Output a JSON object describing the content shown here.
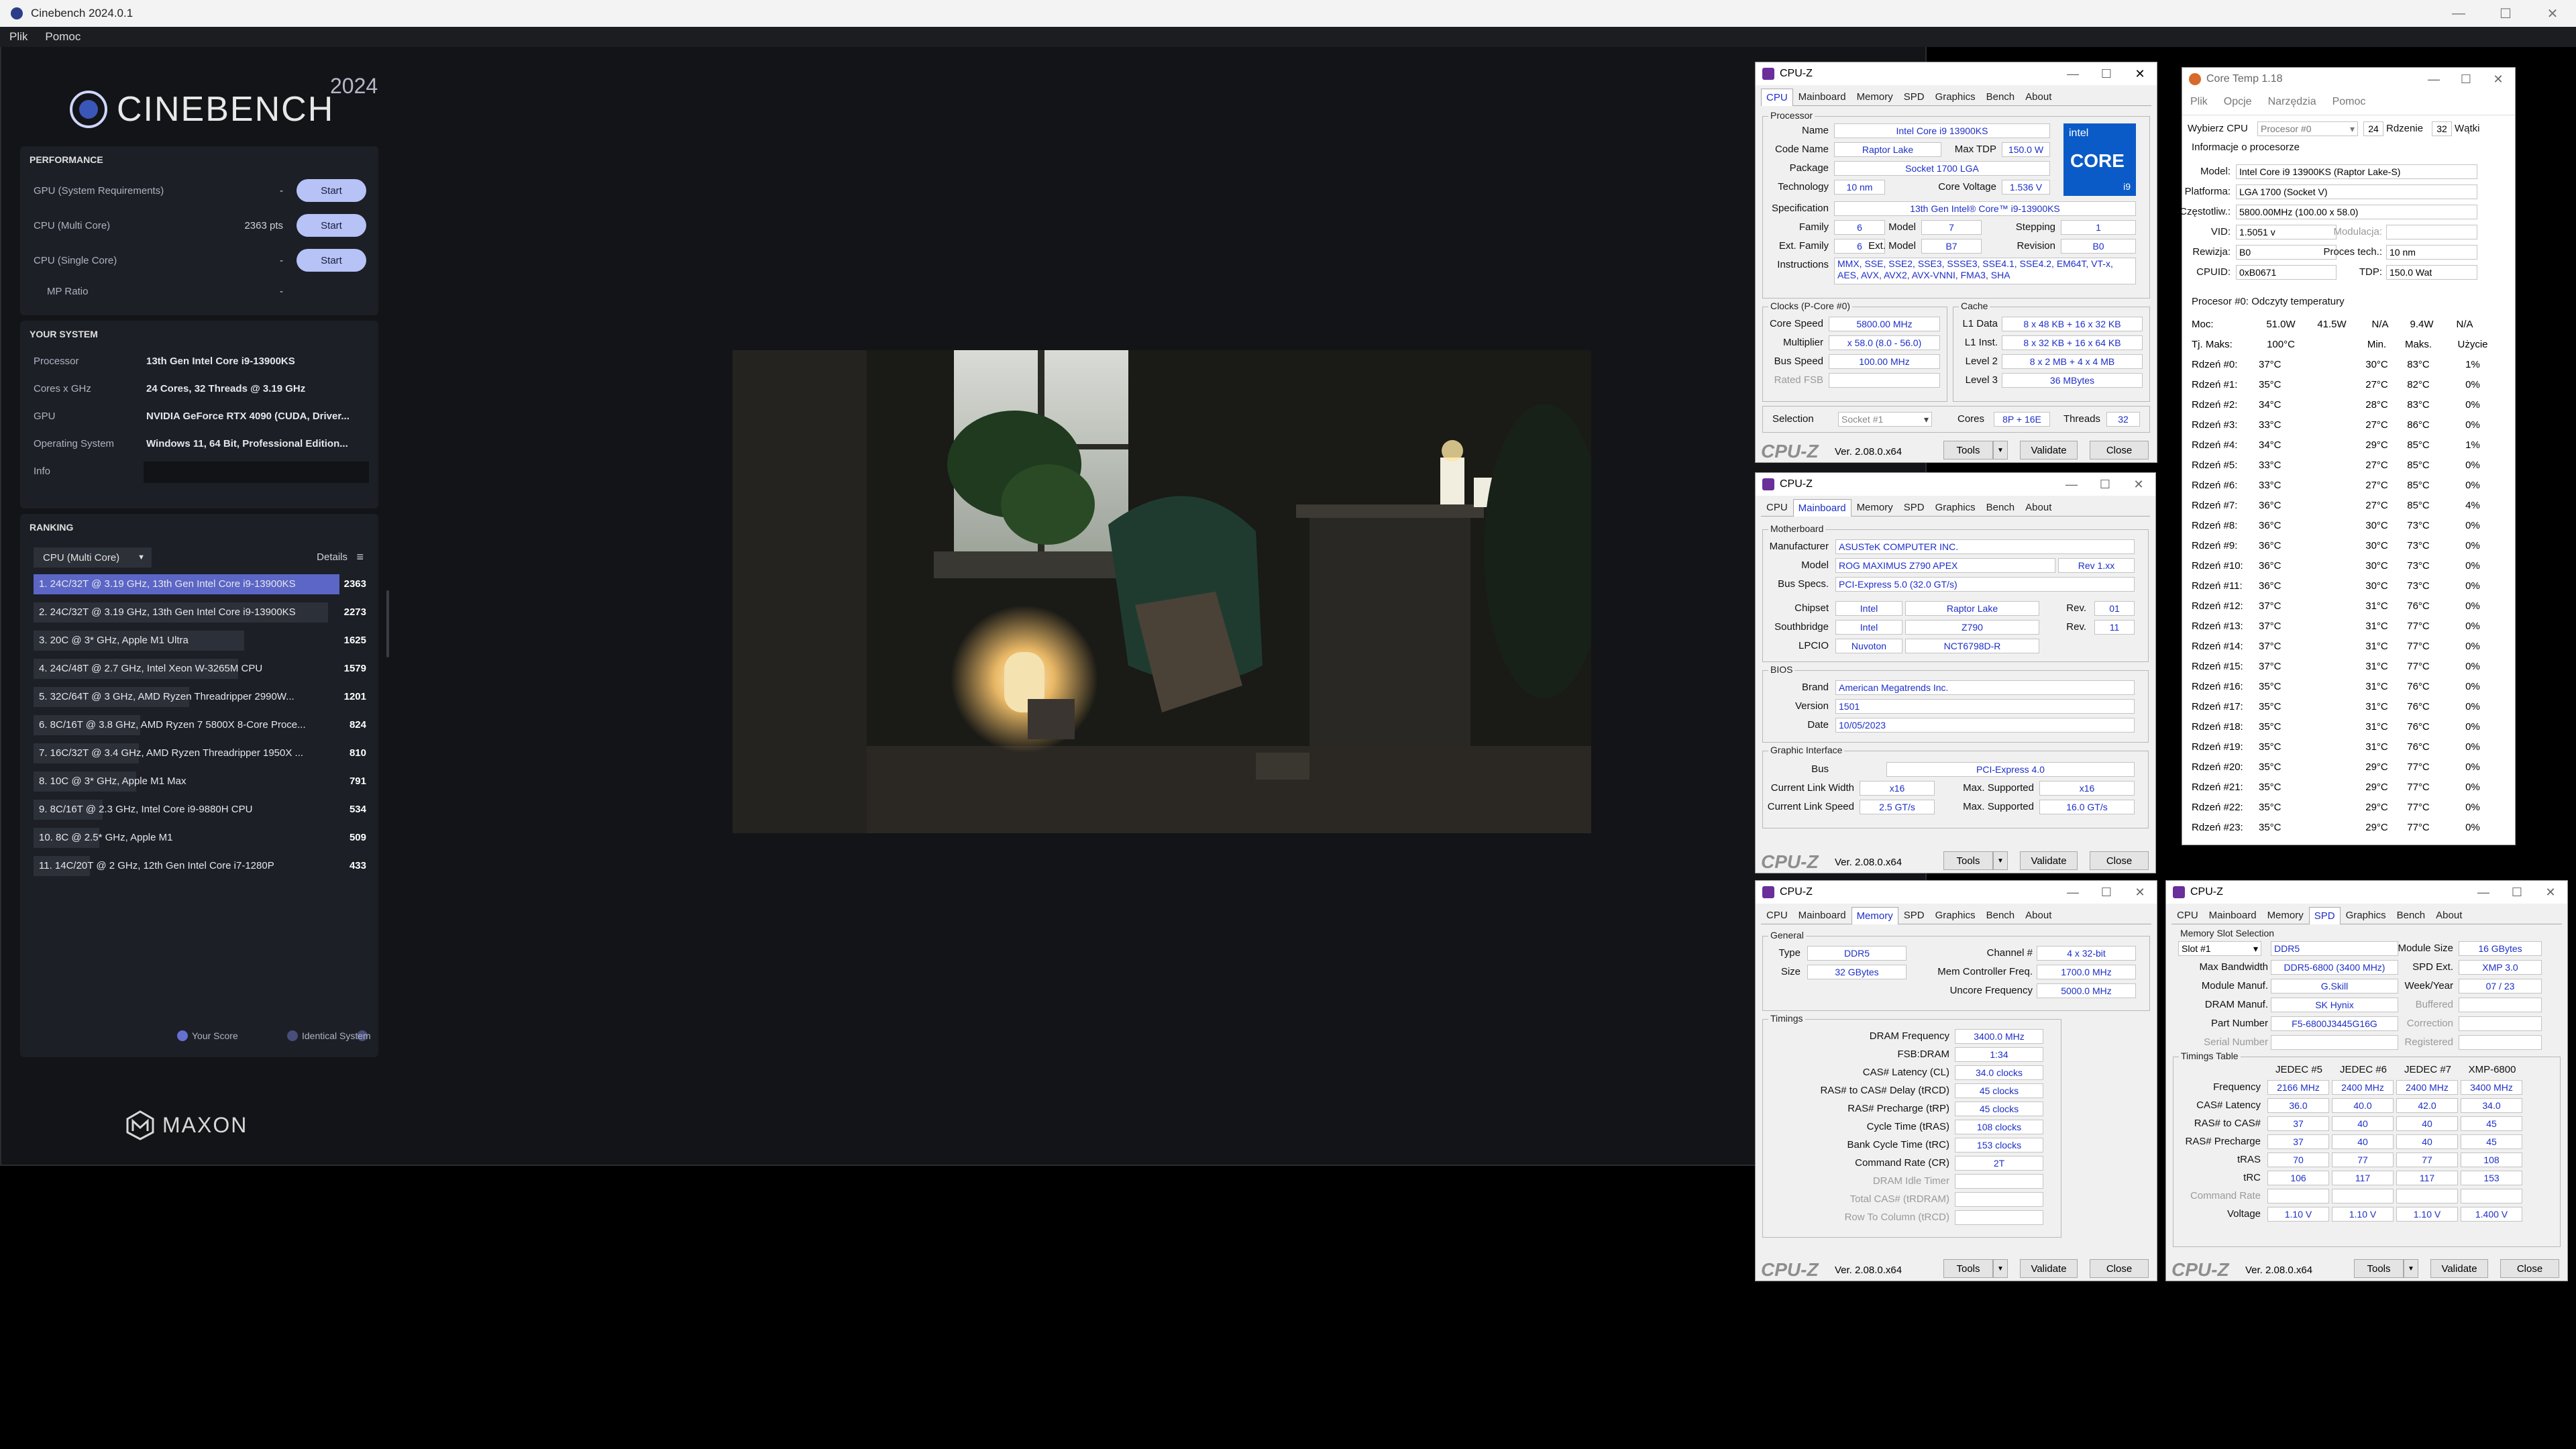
{
  "cinebench": {
    "window_title": "Cinebench 2024.0.1",
    "menu": [
      "Plik",
      "Pomoc"
    ],
    "logo_text": "CINEBENCH",
    "year": "2024",
    "performance": {
      "heading": "PERFORMANCE",
      "rows": [
        {
          "label": "GPU (System Requirements)",
          "value": "-",
          "button": "Start"
        },
        {
          "label": "CPU (Multi Core)",
          "value": "2363 pts",
          "button": "Start"
        },
        {
          "label": "CPU (Single Core)",
          "value": "-",
          "button": "Start"
        },
        {
          "label": "MP Ratio",
          "value": "-"
        }
      ]
    },
    "system": {
      "heading": "YOUR SYSTEM",
      "rows": [
        {
          "label": "Processor",
          "value": "13th Gen Intel Core i9-13900KS"
        },
        {
          "label": "Cores x GHz",
          "value": "24 Cores, 32 Threads @ 3.19 GHz"
        },
        {
          "label": "GPU",
          "value": "NVIDIA GeForce RTX 4090 (CUDA, Driver..."
        },
        {
          "label": "Operating System",
          "value": "Windows 11, 64 Bit, Professional Edition..."
        },
        {
          "label": "Info",
          "value": ""
        }
      ]
    },
    "ranking": {
      "heading": "RANKING",
      "dropdown": "CPU (Multi Core)",
      "details": "Details",
      "items": [
        {
          "label": "1. 24C/32T @ 3.19 GHz, 13th Gen Intel Core i9-13900KS",
          "score": "2363",
          "fraction": 1.0,
          "highlight": true
        },
        {
          "label": "2. 24C/32T @ 3.19 GHz, 13th Gen Intel Core i9-13900KS",
          "score": "2273",
          "fraction": 0.962,
          "highlight": false
        },
        {
          "label": "3. 20C @ 3* GHz, Apple M1 Ultra",
          "score": "1625",
          "fraction": 0.688,
          "highlight": false
        },
        {
          "label": "4. 24C/48T @ 2.7 GHz, Intel Xeon W-3265M CPU",
          "score": "1579",
          "fraction": 0.668,
          "highlight": false
        },
        {
          "label": "5. 32C/64T @ 3 GHz, AMD Ryzen Threadripper 2990W...",
          "score": "1201",
          "fraction": 0.508,
          "highlight": false
        },
        {
          "label": "6. 8C/16T @ 3.8 GHz, AMD Ryzen 7 5800X 8-Core Proce...",
          "score": "824",
          "fraction": 0.349,
          "highlight": false
        },
        {
          "label": "7. 16C/32T @ 3.4 GHz, AMD Ryzen Threadripper 1950X ...",
          "score": "810",
          "fraction": 0.343,
          "highlight": false
        },
        {
          "label": "8. 10C @ 3* GHz, Apple M1 Max",
          "score": "791",
          "fraction": 0.335,
          "highlight": false
        },
        {
          "label": "9. 8C/16T @ 2.3 GHz, Intel Core i9-9880H CPU",
          "score": "534",
          "fraction": 0.226,
          "highlight": false
        },
        {
          "label": "10. 8C @ 2.5* GHz, Apple M1",
          "score": "509",
          "fraction": 0.215,
          "highlight": false
        },
        {
          "label": "11. 14C/20T @ 2 GHz, 12th Gen Intel Core i7-1280P",
          "score": "433",
          "fraction": 0.183,
          "highlight": false
        }
      ],
      "legend": [
        "Your Score",
        "Identical System"
      ]
    },
    "maxon": "MAXON"
  },
  "cpuz_tabs": [
    "CPU",
    "Mainboard",
    "Memory",
    "SPD",
    "Graphics",
    "Bench",
    "About"
  ],
  "cpuz_common": {
    "title": "CPU-Z",
    "brand": "CPU-Z",
    "version": "Ver. 2.08.0.x64",
    "tools": "Tools",
    "validate": "Validate",
    "close": "Close"
  },
  "cpu": {
    "processor_legend": "Processor",
    "name_l": "Name",
    "name": "Intel Core i9 13900KS",
    "codename_l": "Code Name",
    "codename": "Raptor Lake",
    "maxtdp_l": "Max TDP",
    "maxtdp": "150.0 W",
    "package_l": "Package",
    "package": "Socket 1700 LGA",
    "tech_l": "Technology",
    "tech": "10 nm",
    "cv_l": "Core Voltage",
    "cv": "1.536 V",
    "spec_l": "Specification",
    "spec": "13th Gen Intel® Core™ i9-13900KS",
    "family_l": "Family",
    "family": "6",
    "model_l": "Model",
    "model": "7",
    "stepping_l": "Stepping",
    "stepping": "1",
    "extfam_l": "Ext. Family",
    "extfam": "6",
    "extmod_l": "Ext. Model",
    "extmod": "B7",
    "rev_l": "Revision",
    "rev": "B0",
    "instr_l": "Instructions",
    "instr": "MMX, SSE, SSE2, SSE3, SSSE3, SSE4.1, SSE4.2, EM64T, VT-x, AES, AVX, AVX2, AVX-VNNI, FMA3, SHA",
    "intel_badge": [
      "intel",
      "CORE",
      "i9"
    ],
    "clocks_legend": "Clocks (P-Core #0)",
    "cs_l": "Core Speed",
    "cs": "5800.00 MHz",
    "mult_l": "Multiplier",
    "mult": "x 58.0 (8.0 - 56.0)",
    "bus_l": "Bus Speed",
    "bus": "100.00 MHz",
    "fsb_l": "Rated FSB",
    "cache_legend": "Cache",
    "l1d_l": "L1 Data",
    "l1d": "8 x 48 KB + 16 x 32 KB",
    "l1i_l": "L1 Inst.",
    "l1i": "8 x 32 KB + 16 x 64 KB",
    "l2_l": "Level 2",
    "l2": "8 x 2 MB + 4 x 4 MB",
    "l3_l": "Level 3",
    "l3": "36 MBytes",
    "sel_l": "Selection",
    "sel": "Socket #1",
    "cores_l": "Cores",
    "cores": "8P + 16E",
    "threads_l": "Threads",
    "threads": "32"
  },
  "mainboard": {
    "mb_legend": "Motherboard",
    "manu_l": "Manufacturer",
    "manu": "ASUSTeK COMPUTER INC.",
    "model_l": "Model",
    "model": "ROG MAXIMUS Z790 APEX",
    "rev": "Rev 1.xx",
    "busspec_l": "Bus Specs.",
    "busspec": "PCI-Express 5.0 (32.0 GT/s)",
    "chipset_l": "Chipset",
    "chipset": "Intel",
    "chipset2": "Raptor Lake",
    "chiprev_l": "Rev.",
    "chiprev": "01",
    "south_l": "Southbridge",
    "south": "Intel",
    "south2": "Z790",
    "southrev_l": "Rev.",
    "southrev": "11",
    "lpcio_l": "LPCIO",
    "lpcio": "Nuvoton",
    "lpcio2": "NCT6798D-R",
    "bios_legend": "BIOS",
    "brand_l": "Brand",
    "brand": "American Megatrends Inc.",
    "version_l": "Version",
    "version": "1501",
    "date_l": "Date",
    "date": "10/05/2023",
    "gi_legend": "Graphic Interface",
    "gbus_l": "Bus",
    "gbus": "PCI-Express 4.0",
    "clw_l": "Current Link Width",
    "clw": "x16",
    "msw_l": "Max. Supported",
    "msw": "x16",
    "cls_l": "Current Link Speed",
    "cls": "2.5 GT/s",
    "mss_l": "Max. Supported",
    "mss": "16.0 GT/s"
  },
  "memory": {
    "gen_legend": "General",
    "type_l": "Type",
    "type": "DDR5",
    "size_l": "Size",
    "size": "32 GBytes",
    "chan_l": "Channel #",
    "chan": "4 x 32-bit",
    "mcf_l": "Mem Controller Freq.",
    "mcf": "1700.0 MHz",
    "ucf_l": "Uncore Frequency",
    "ucf": "5000.0 MHz",
    "tim_legend": "Timings",
    "timings": [
      {
        "l": "DRAM Frequency",
        "v": "3400.0 MHz",
        "dim": false
      },
      {
        "l": "FSB:DRAM",
        "v": "1:34",
        "dim": false
      },
      {
        "l": "CAS# Latency (CL)",
        "v": "34.0 clocks",
        "dim": false
      },
      {
        "l": "RAS# to CAS# Delay (tRCD)",
        "v": "45 clocks",
        "dim": false
      },
      {
        "l": "RAS# Precharge (tRP)",
        "v": "45 clocks",
        "dim": false
      },
      {
        "l": "Cycle Time (tRAS)",
        "v": "108 clocks",
        "dim": false
      },
      {
        "l": "Bank Cycle Time (tRC)",
        "v": "153 clocks",
        "dim": false
      },
      {
        "l": "Command Rate (CR)",
        "v": "2T",
        "dim": false
      },
      {
        "l": "DRAM Idle Timer",
        "v": "",
        "dim": true
      },
      {
        "l": "Total CAS# (tRDRAM)",
        "v": "",
        "dim": true
      },
      {
        "l": "Row To Column (tRCD)",
        "v": "",
        "dim": true
      }
    ]
  },
  "spd": {
    "slot_legend": "Memory Slot Selection",
    "slot": "Slot #1",
    "type": "DDR5",
    "modsize_l": "Module Size",
    "modsize": "16 GBytes",
    "maxbw_l": "Max Bandwidth",
    "maxbw": "DDR5-6800 (3400 MHz)",
    "spdext_l": "SPD Ext.",
    "spdext": "XMP 3.0",
    "modmanu_l": "Module Manuf.",
    "modmanu": "G.Skill",
    "week_l": "Week/Year",
    "week": "07 / 23",
    "dram_l": "DRAM Manuf.",
    "dram": "SK Hynix",
    "buff_l": "Buffered",
    "part_l": "Part Number",
    "part": "F5-6800J3445G16G",
    "corr_l": "Correction",
    "serial_l": "Serial Number",
    "reg_l": "Registered",
    "tt_legend": "Timings Table",
    "cols": [
      "JEDEC #5",
      "JEDEC #6",
      "JEDEC #7",
      "XMP-6800"
    ],
    "rows": [
      {
        "l": "Frequency",
        "v": [
          "2166 MHz",
          "2400 MHz",
          "2400 MHz",
          "3400 MHz"
        ],
        "dim": false
      },
      {
        "l": "CAS# Latency",
        "v": [
          "36.0",
          "40.0",
          "42.0",
          "34.0"
        ],
        "dim": false
      },
      {
        "l": "RAS# to CAS#",
        "v": [
          "37",
          "40",
          "40",
          "45"
        ],
        "dim": false
      },
      {
        "l": "RAS# Precharge",
        "v": [
          "37",
          "40",
          "40",
          "45"
        ],
        "dim": false
      },
      {
        "l": "tRAS",
        "v": [
          "70",
          "77",
          "77",
          "108"
        ],
        "dim": false
      },
      {
        "l": "tRC",
        "v": [
          "106",
          "117",
          "117",
          "153"
        ],
        "dim": false
      },
      {
        "l": "Command Rate",
        "v": [
          "",
          "",
          "",
          ""
        ],
        "dim": true
      },
      {
        "l": "Voltage",
        "v": [
          "1.10 V",
          "1.10 V",
          "1.10 V",
          "1.400 V"
        ],
        "dim": false
      }
    ]
  },
  "coretemp": {
    "title": "Core Temp 1.18",
    "menu": [
      "Plik",
      "Opcje",
      "Narzędzia",
      "Pomoc"
    ],
    "select_l": "Wybierz CPU",
    "select": "Procesor #0",
    "cores_n": "24",
    "cores_l": "Rdzenie",
    "threads_n": "32",
    "threads_l": "Wątki",
    "info_h": "Informacje o procesorze",
    "model_l": "Model:",
    "model": "Intel Core i9 13900KS (Raptor Lake-S)",
    "plat_l": "Platforma:",
    "plat": "LGA 1700 (Socket V)",
    "freq_l": "Częstotliw.:",
    "freq": "5800.00MHz (100.00 x 58.0)",
    "vid_l": "VID:",
    "vid": "1.5051 v",
    "mod_l": "Modulacja:",
    "rev_l": "Rewizja:",
    "rev": "B0",
    "proc_l": "Proces tech.:",
    "proc": "10 nm",
    "cpuid_l": "CPUID:",
    "cpuid": "0xB0671",
    "tdp_l": "TDP:",
    "tdp": "150.0 Wat",
    "temps_h": "Procesor #0: Odczyty temperatury",
    "power_l": "Moc:",
    "power": [
      "51.0W",
      "41.5W",
      "N/A",
      "9.4W",
      "N/A"
    ],
    "tj_l": "Tj. Maks:",
    "tj": "100°C",
    "min_h": "Min.",
    "max_h": "Maks.",
    "use_h": "Użycie",
    "cores": [
      {
        "n": "Rdzeń #0:",
        "t": "37°C",
        "mn": "30°C",
        "mx": "83°C",
        "u": "1%"
      },
      {
        "n": "Rdzeń #1:",
        "t": "35°C",
        "mn": "27°C",
        "mx": "82°C",
        "u": "0%"
      },
      {
        "n": "Rdzeń #2:",
        "t": "34°C",
        "mn": "28°C",
        "mx": "83°C",
        "u": "0%"
      },
      {
        "n": "Rdzeń #3:",
        "t": "33°C",
        "mn": "27°C",
        "mx": "86°C",
        "u": "0%"
      },
      {
        "n": "Rdzeń #4:",
        "t": "34°C",
        "mn": "29°C",
        "mx": "85°C",
        "u": "1%"
      },
      {
        "n": "Rdzeń #5:",
        "t": "33°C",
        "mn": "27°C",
        "mx": "85°C",
        "u": "0%"
      },
      {
        "n": "Rdzeń #6:",
        "t": "33°C",
        "mn": "27°C",
        "mx": "85°C",
        "u": "0%"
      },
      {
        "n": "Rdzeń #7:",
        "t": "36°C",
        "mn": "27°C",
        "mx": "85°C",
        "u": "4%"
      },
      {
        "n": "Rdzeń #8:",
        "t": "36°C",
        "mn": "30°C",
        "mx": "73°C",
        "u": "0%"
      },
      {
        "n": "Rdzeń #9:",
        "t": "36°C",
        "mn": "30°C",
        "mx": "73°C",
        "u": "0%"
      },
      {
        "n": "Rdzeń #10:",
        "t": "36°C",
        "mn": "30°C",
        "mx": "73°C",
        "u": "0%"
      },
      {
        "n": "Rdzeń #11:",
        "t": "36°C",
        "mn": "30°C",
        "mx": "73°C",
        "u": "0%"
      },
      {
        "n": "Rdzeń #12:",
        "t": "37°C",
        "mn": "31°C",
        "mx": "76°C",
        "u": "0%"
      },
      {
        "n": "Rdzeń #13:",
        "t": "37°C",
        "mn": "31°C",
        "mx": "77°C",
        "u": "0%"
      },
      {
        "n": "Rdzeń #14:",
        "t": "37°C",
        "mn": "31°C",
        "mx": "77°C",
        "u": "0%"
      },
      {
        "n": "Rdzeń #15:",
        "t": "37°C",
        "mn": "31°C",
        "mx": "77°C",
        "u": "0%"
      },
      {
        "n": "Rdzeń #16:",
        "t": "35°C",
        "mn": "31°C",
        "mx": "76°C",
        "u": "0%"
      },
      {
        "n": "Rdzeń #17:",
        "t": "35°C",
        "mn": "31°C",
        "mx": "76°C",
        "u": "0%"
      },
      {
        "n": "Rdzeń #18:",
        "t": "35°C",
        "mn": "31°C",
        "mx": "76°C",
        "u": "0%"
      },
      {
        "n": "Rdzeń #19:",
        "t": "35°C",
        "mn": "31°C",
        "mx": "76°C",
        "u": "0%"
      },
      {
        "n": "Rdzeń #20:",
        "t": "35°C",
        "mn": "29°C",
        "mx": "77°C",
        "u": "0%"
      },
      {
        "n": "Rdzeń #21:",
        "t": "35°C",
        "mn": "29°C",
        "mx": "77°C",
        "u": "0%"
      },
      {
        "n": "Rdzeń #22:",
        "t": "35°C",
        "mn": "29°C",
        "mx": "77°C",
        "u": "0%"
      },
      {
        "n": "Rdzeń #23:",
        "t": "35°C",
        "mn": "29°C",
        "mx": "77°C",
        "u": "0%"
      }
    ]
  }
}
